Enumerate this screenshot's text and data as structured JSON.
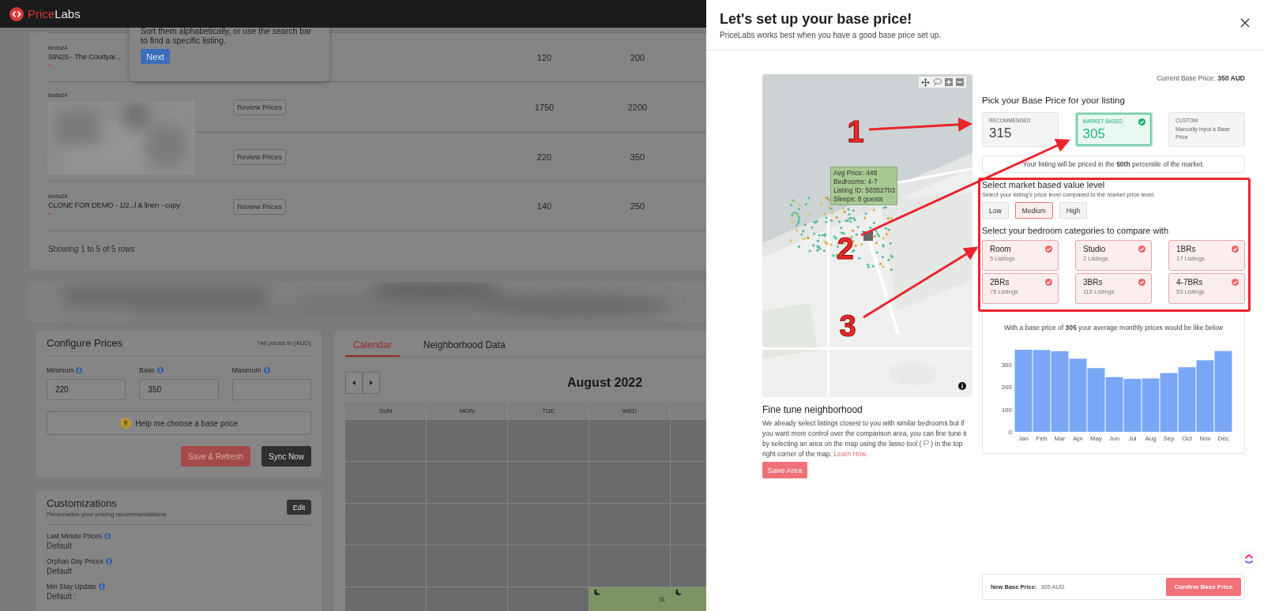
{
  "brand": {
    "first": "Price",
    "second": "Labs"
  },
  "tour_popover": {
    "text": "Sort them alphabetically, or use the search bar to find a specific listing.",
    "button": "Next"
  },
  "listings": {
    "rows": [
      {
        "kind": "listing",
        "source": "beds24",
        "name": "StN2S - The Courtyar...",
        "marker": "*",
        "column_3": "120",
        "column_4": "200"
      },
      {
        "kind": "blurred",
        "source": "beds24",
        "review_button": "Review Prices",
        "column_3": "1750",
        "column_4": "2200"
      },
      {
        "kind": "plain",
        "review_button": "Review Prices",
        "column_3": "220",
        "column_4": "350"
      },
      {
        "kind": "listing",
        "source": "beds24",
        "name": "CLONE FOR DEMO - 1/2...l & linen - copy",
        "marker": "*",
        "review_button": "Review Prices",
        "column_3": "140",
        "column_4": "250"
      }
    ],
    "footer": "Showing 1 to 5 of 5 rows"
  },
  "configure_prices": {
    "title": "Configure Prices",
    "note": "*All prices in (AUD)",
    "fields": [
      {
        "label": "Minimum",
        "value": "220"
      },
      {
        "label": "Base",
        "value": "350"
      },
      {
        "label": "Maximum"
      }
    ],
    "help_button": "Help me choose a base price",
    "buttons": [
      {
        "label": "Save & Refresh",
        "kind": "primary"
      },
      {
        "label": "Sync Now",
        "kind": "dark"
      }
    ]
  },
  "customizations": {
    "title": "Customizations",
    "subtitle": "Personalize your pricing recommendations",
    "edit_button": "Edit",
    "items": [
      {
        "label": "Last Minute Prices",
        "value": "Default"
      },
      {
        "label": "Orphan Day Prices",
        "value": "Default"
      },
      {
        "label": "Min Stay Update",
        "value": "Default :"
      }
    ]
  },
  "calendar": {
    "tabs": [
      {
        "label": "Calendar",
        "selected": true
      },
      {
        "label": "Neighborhood Data",
        "selected": false
      }
    ],
    "month": "August 2022",
    "weekdays": [
      "SUN",
      "MON",
      "TUE",
      "WED"
    ],
    "weeks": [
      {
        "cells": [
          {
            "kind": "empty"
          },
          {
            "kind": "empty"
          },
          {
            "kind": "empty"
          },
          {
            "kind": "empty"
          },
          {
            "kind": "empty"
          }
        ]
      },
      {
        "cells": [
          {
            "kind": "empty"
          },
          {
            "kind": "empty"
          },
          {
            "kind": "empty"
          },
          {
            "kind": "empty"
          },
          {
            "kind": "empty"
          }
        ]
      },
      {
        "cells": [
          {
            "kind": "empty"
          },
          {
            "kind": "empty"
          },
          {
            "kind": "empty"
          },
          {
            "kind": "empty"
          },
          {
            "kind": "empty"
          }
        ]
      },
      {
        "cells": [
          {
            "kind": "empty"
          },
          {
            "kind": "empty"
          },
          {
            "kind": "empty"
          },
          {
            "kind": "empty"
          },
          {
            "kind": "empty"
          }
        ]
      },
      {
        "cells": [
          {
            "kind": "empty"
          },
          {
            "kind": "empty"
          },
          {
            "kind": "empty"
          },
          {
            "kind": "available",
            "day": "31"
          },
          {
            "kind": "available"
          }
        ]
      }
    ]
  },
  "drawer": {
    "title": "Let's set up your base price!",
    "subtitle": "PriceLabs works best when you have a good base price set up.",
    "map": {
      "tooltip": [
        "Avg Price: 448",
        "Bedrooms: 4-7",
        "Listing ID: 50352703",
        "Sleeps: 8 guests"
      ]
    },
    "fine_tune": {
      "title": "Fine tune neighborhood",
      "text_before": "We already select listings closest to you with similar bedrooms but if you want more control over the comparison area, you can fine tune it by selecting an area on the map using the lasso tool (",
      "text_after": ") in the top right corner of the map.",
      "link": "Learn How.",
      "button": "Save Area"
    },
    "current_base_price": {
      "label": "Current Base Price:",
      "value": "350 AUD"
    },
    "pick": {
      "title": "Pick your Base Price for your listing",
      "options": [
        {
          "label": "RECOMMENDED",
          "value": "315",
          "selected": false
        },
        {
          "label": "MARKET BASED",
          "value": "305",
          "selected": true
        },
        {
          "label": "CUSTOM",
          "description": "Manually input a Base Price",
          "selected": false
        }
      ]
    },
    "percentile": "Your listing will be priced in the **50th** percentile of the market.",
    "value_level": {
      "title": "Select market based value level",
      "subtitle": "Select your listing's price level compared to the market price level.",
      "options": [
        {
          "label": "Low",
          "selected": false
        },
        {
          "label": "Medium",
          "selected": true
        },
        {
          "label": "High",
          "selected": false
        }
      ]
    },
    "bedrooms": {
      "title": "Select your bedroom categories to compare with",
      "categories": [
        {
          "name": "Room",
          "count": "5 Listings",
          "checked": true
        },
        {
          "name": "Studio",
          "count": "2 Listings",
          "checked": true
        },
        {
          "name": "1BRs",
          "count": "17 Listings",
          "checked": true
        },
        {
          "name": "2BRs",
          "count": "75 Listings",
          "checked": true
        },
        {
          "name": "3BRs",
          "count": "115 Listings",
          "checked": true
        },
        {
          "name": "4-7BRs",
          "count": "53 Listings",
          "checked": true
        }
      ]
    },
    "chart": {
      "caption": "With a base price of **305** your average monthly prices would be like below",
      "chart_data": {
        "type": "bar",
        "categories": [
          "Jan",
          "Feb",
          "Mar",
          "Apr",
          "May",
          "Jun",
          "Jul",
          "Aug",
          "Sep",
          "Oct",
          "Nov",
          "Dec"
        ],
        "series": [
          {
            "color": "#79a7f5",
            "values": [
              366,
              365,
              359,
              326,
              284,
              244,
              236,
              238,
              262,
              288,
              319,
              360
            ]
          }
        ],
        "ylim": [
          0,
          366
        ],
        "yticks": [
          0,
          100,
          200,
          300
        ]
      }
    },
    "footer": {
      "label": "New Base Price:",
      "value": "305 AUD",
      "button": "Confirm Base Price"
    }
  },
  "annotations": [
    {
      "label": "1"
    },
    {
      "label": "2"
    },
    {
      "label": "3"
    }
  ]
}
